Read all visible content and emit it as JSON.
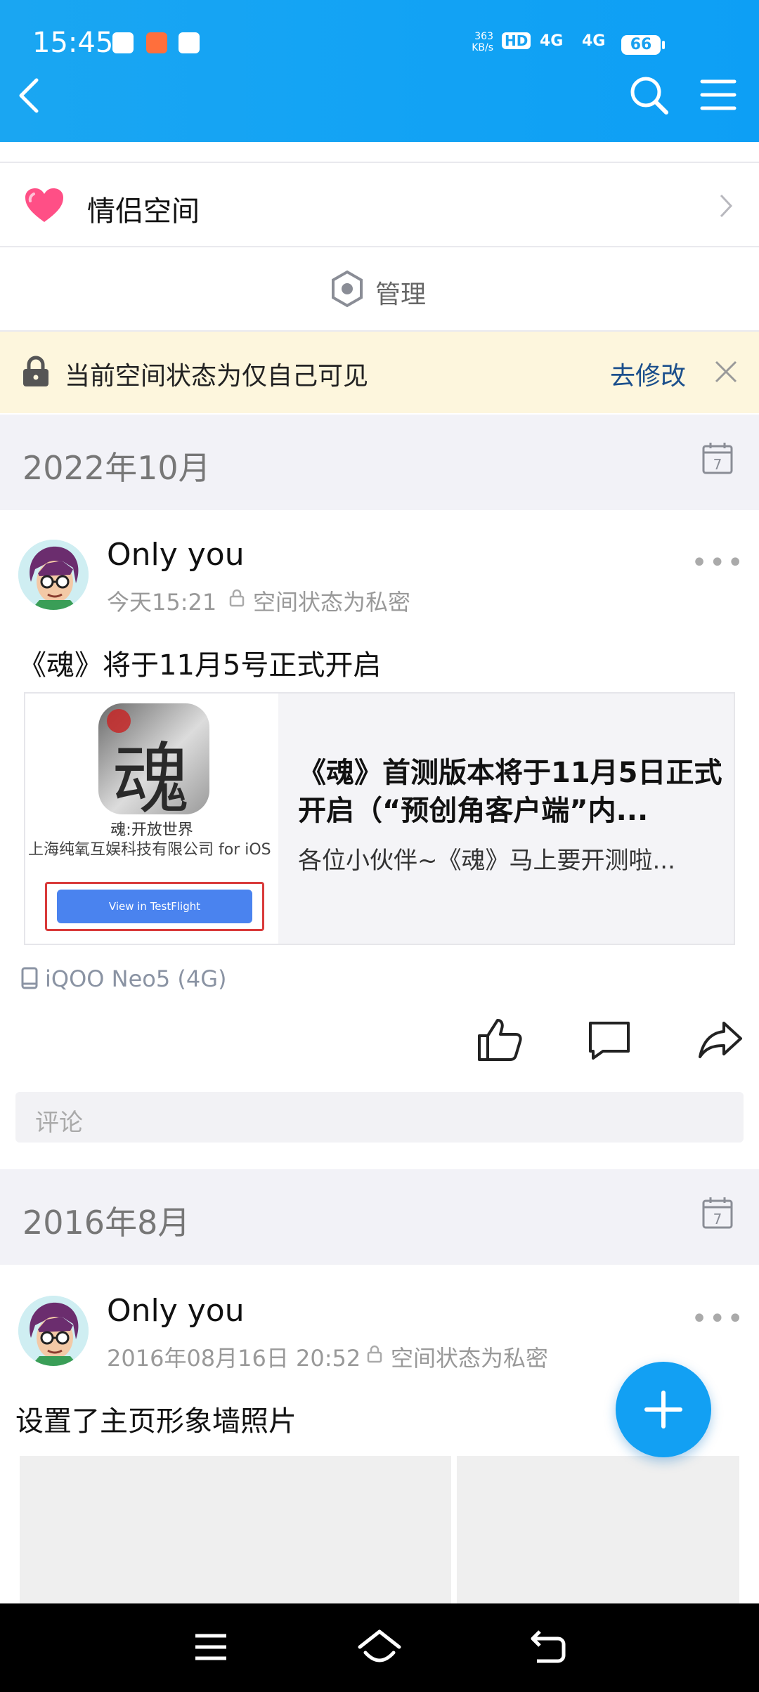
{
  "status_bar": {
    "time": "15:45",
    "net_speed_top": "363",
    "net_speed_bottom": "KB/s",
    "hd_tag": "HD",
    "sim1_tag": "4G",
    "sim2_tag": "4G",
    "battery": "66"
  },
  "header": {
    "back_icon": "chevron-left",
    "search_icon": "search",
    "menu_icon": "hamburger"
  },
  "couple_space": {
    "label": "情侣空间",
    "icon": "heart",
    "color": "#ff4f86"
  },
  "manage": {
    "label": "管理"
  },
  "notice": {
    "text": "当前空间状态为仅自己可见",
    "action": "去修改"
  },
  "sections": [
    {
      "month": "2022年10月",
      "post": {
        "author": "Only you",
        "time": "今天15:21",
        "privacy": "空间状态为私密",
        "text": "《魂》将于11月5号正式开启",
        "share": {
          "thumb_caption": "魂:开放世界",
          "thumb_company": "上海纯氧互娱科技有限公司 for iOS",
          "thumb_button": "View in TestFlight",
          "title": "《魂》首测版本将于11月5日正式开启（“预创角客户端”内...",
          "desc": "各位小伙伴~《魂》马上要开测啦..."
        },
        "device": "iQOO Neo5 (4G)",
        "comment_placeholder": "评论"
      }
    },
    {
      "month": "2016年8月",
      "post": {
        "author": "Only you",
        "time": "2016年08月16日 20:52",
        "privacy": "空间状态为私密",
        "text": "设置了主页形象墙照片"
      }
    }
  ],
  "colors": {
    "accent": "#12a0f3",
    "notice_bg": "#fdf6dd",
    "link": "#1b4f8c"
  }
}
